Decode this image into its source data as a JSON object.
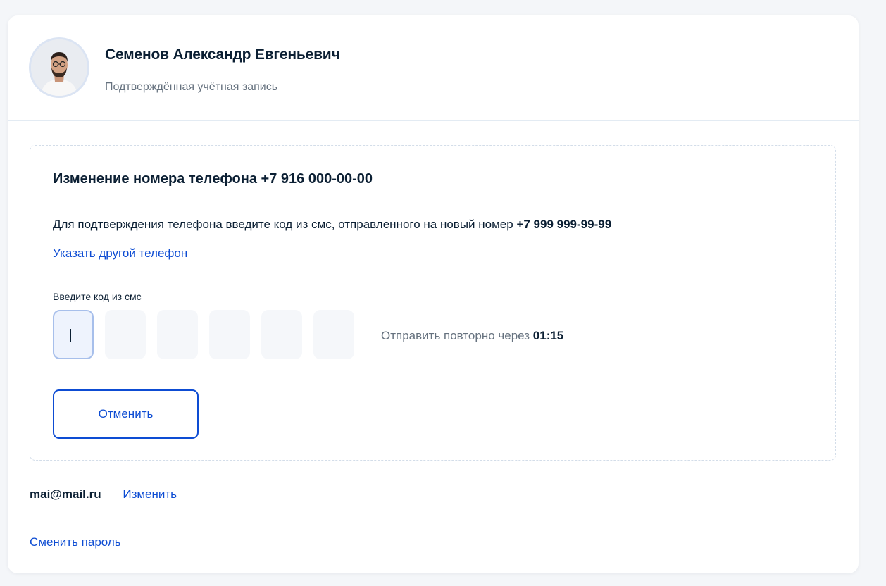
{
  "profile": {
    "name": "Семенов Александр Евгеньевич",
    "status": "Подтверждённая учётная запись",
    "avatar_icon": "user-photo"
  },
  "phone_change": {
    "title": "Изменение номера телефона +7 916 000-00-00",
    "description": "Для подтверждения телефона введите код из смс, отправленного на новый номер ",
    "new_number": "+7 999 999-99-99",
    "change_link": "Указать другой телефон",
    "code_label": "Введите код из смс",
    "code_cells": [
      "",
      "",
      "",
      "",
      "",
      ""
    ],
    "resend_text": "Отправить повторно через ",
    "resend_timer": "01:15",
    "cancel_label": "Отменить"
  },
  "email": {
    "value": "mai@mail.ru",
    "change_label": "Изменить"
  },
  "password": {
    "change_label": "Сменить пароль"
  },
  "colors": {
    "accent": "#0d4cd3",
    "text": "#0b1f33",
    "muted": "#66727f",
    "background": "#f4f6f9"
  }
}
